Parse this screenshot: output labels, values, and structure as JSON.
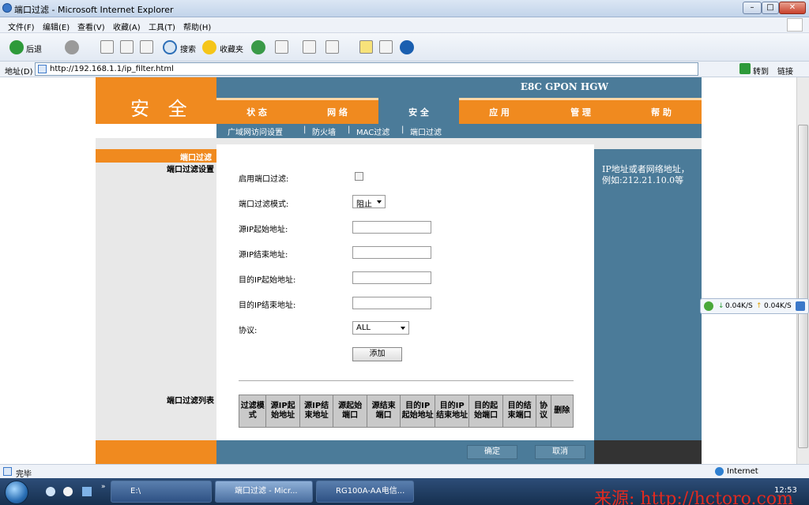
{
  "window": {
    "title": "端口过滤 - Microsoft Internet Explorer",
    "minimize": "–",
    "maximize": "□",
    "close": "✕"
  },
  "menu": [
    "文件(F)",
    "编辑(E)",
    "查看(V)",
    "收藏(A)",
    "工具(T)",
    "帮助(H)"
  ],
  "toolbar": {
    "back_label": "后退",
    "search_label": "搜索",
    "favorites_label": "收藏夹"
  },
  "address": {
    "label": "地址(D)",
    "url": "http://192.168.1.1/ip_filter.html",
    "go_label": "转到",
    "links_label": "链接"
  },
  "router": {
    "section_title": "安 全",
    "product": "E8C GPON HGW",
    "nav": [
      "状 态",
      "网 络",
      "安 全",
      "应 用",
      "管 理",
      "帮 助"
    ],
    "active_nav": 2,
    "subnav": [
      "广域网访问设置",
      "防火墙",
      "MAC过滤",
      "端口过滤"
    ],
    "left": {
      "current": "端口过滤",
      "settings_heading": "端口过滤设置",
      "list_heading": "端口过滤列表"
    },
    "form": {
      "enable_label": "启用端口过滤:",
      "enable_checked": false,
      "mode_label": "端口过滤模式:",
      "mode_value": "阻止",
      "src_ip_start_label": "源IP起始地址:",
      "src_ip_end_label": "源IP结束地址:",
      "dst_ip_start_label": "目的IP起始地址:",
      "dst_ip_end_label": "目的IP结束地址:",
      "protocol_label": "协议:",
      "protocol_value": "ALL",
      "add_button": "添加"
    },
    "table_headers": [
      "过滤模式",
      "源IP起始地址",
      "源IP结束地址",
      "源起始端口",
      "源结束端口",
      "目的IP起始地址",
      "目的IP结束地址",
      "目的起始端口",
      "目的结束端口",
      "协议",
      "删除"
    ],
    "help_text": "IP地址或者网络地址，例如:212.21.10.0等",
    "footer": {
      "ok": "确定",
      "cancel": "取消"
    }
  },
  "net_widget": {
    "down": "0.04K/S",
    "up": "0.04K/S"
  },
  "status": {
    "text": "完毕",
    "zone": "Internet"
  },
  "taskbar": {
    "explorer_item": "E:\\",
    "tasks": [
      "端口过滤 - Micr...",
      "RG100A-AA电信..."
    ],
    "clock": "12:53",
    "watermark": "来源: http://hctoro.com"
  },
  "colors": {
    "orange": "#f08a1f",
    "blue": "#4b7b99"
  }
}
